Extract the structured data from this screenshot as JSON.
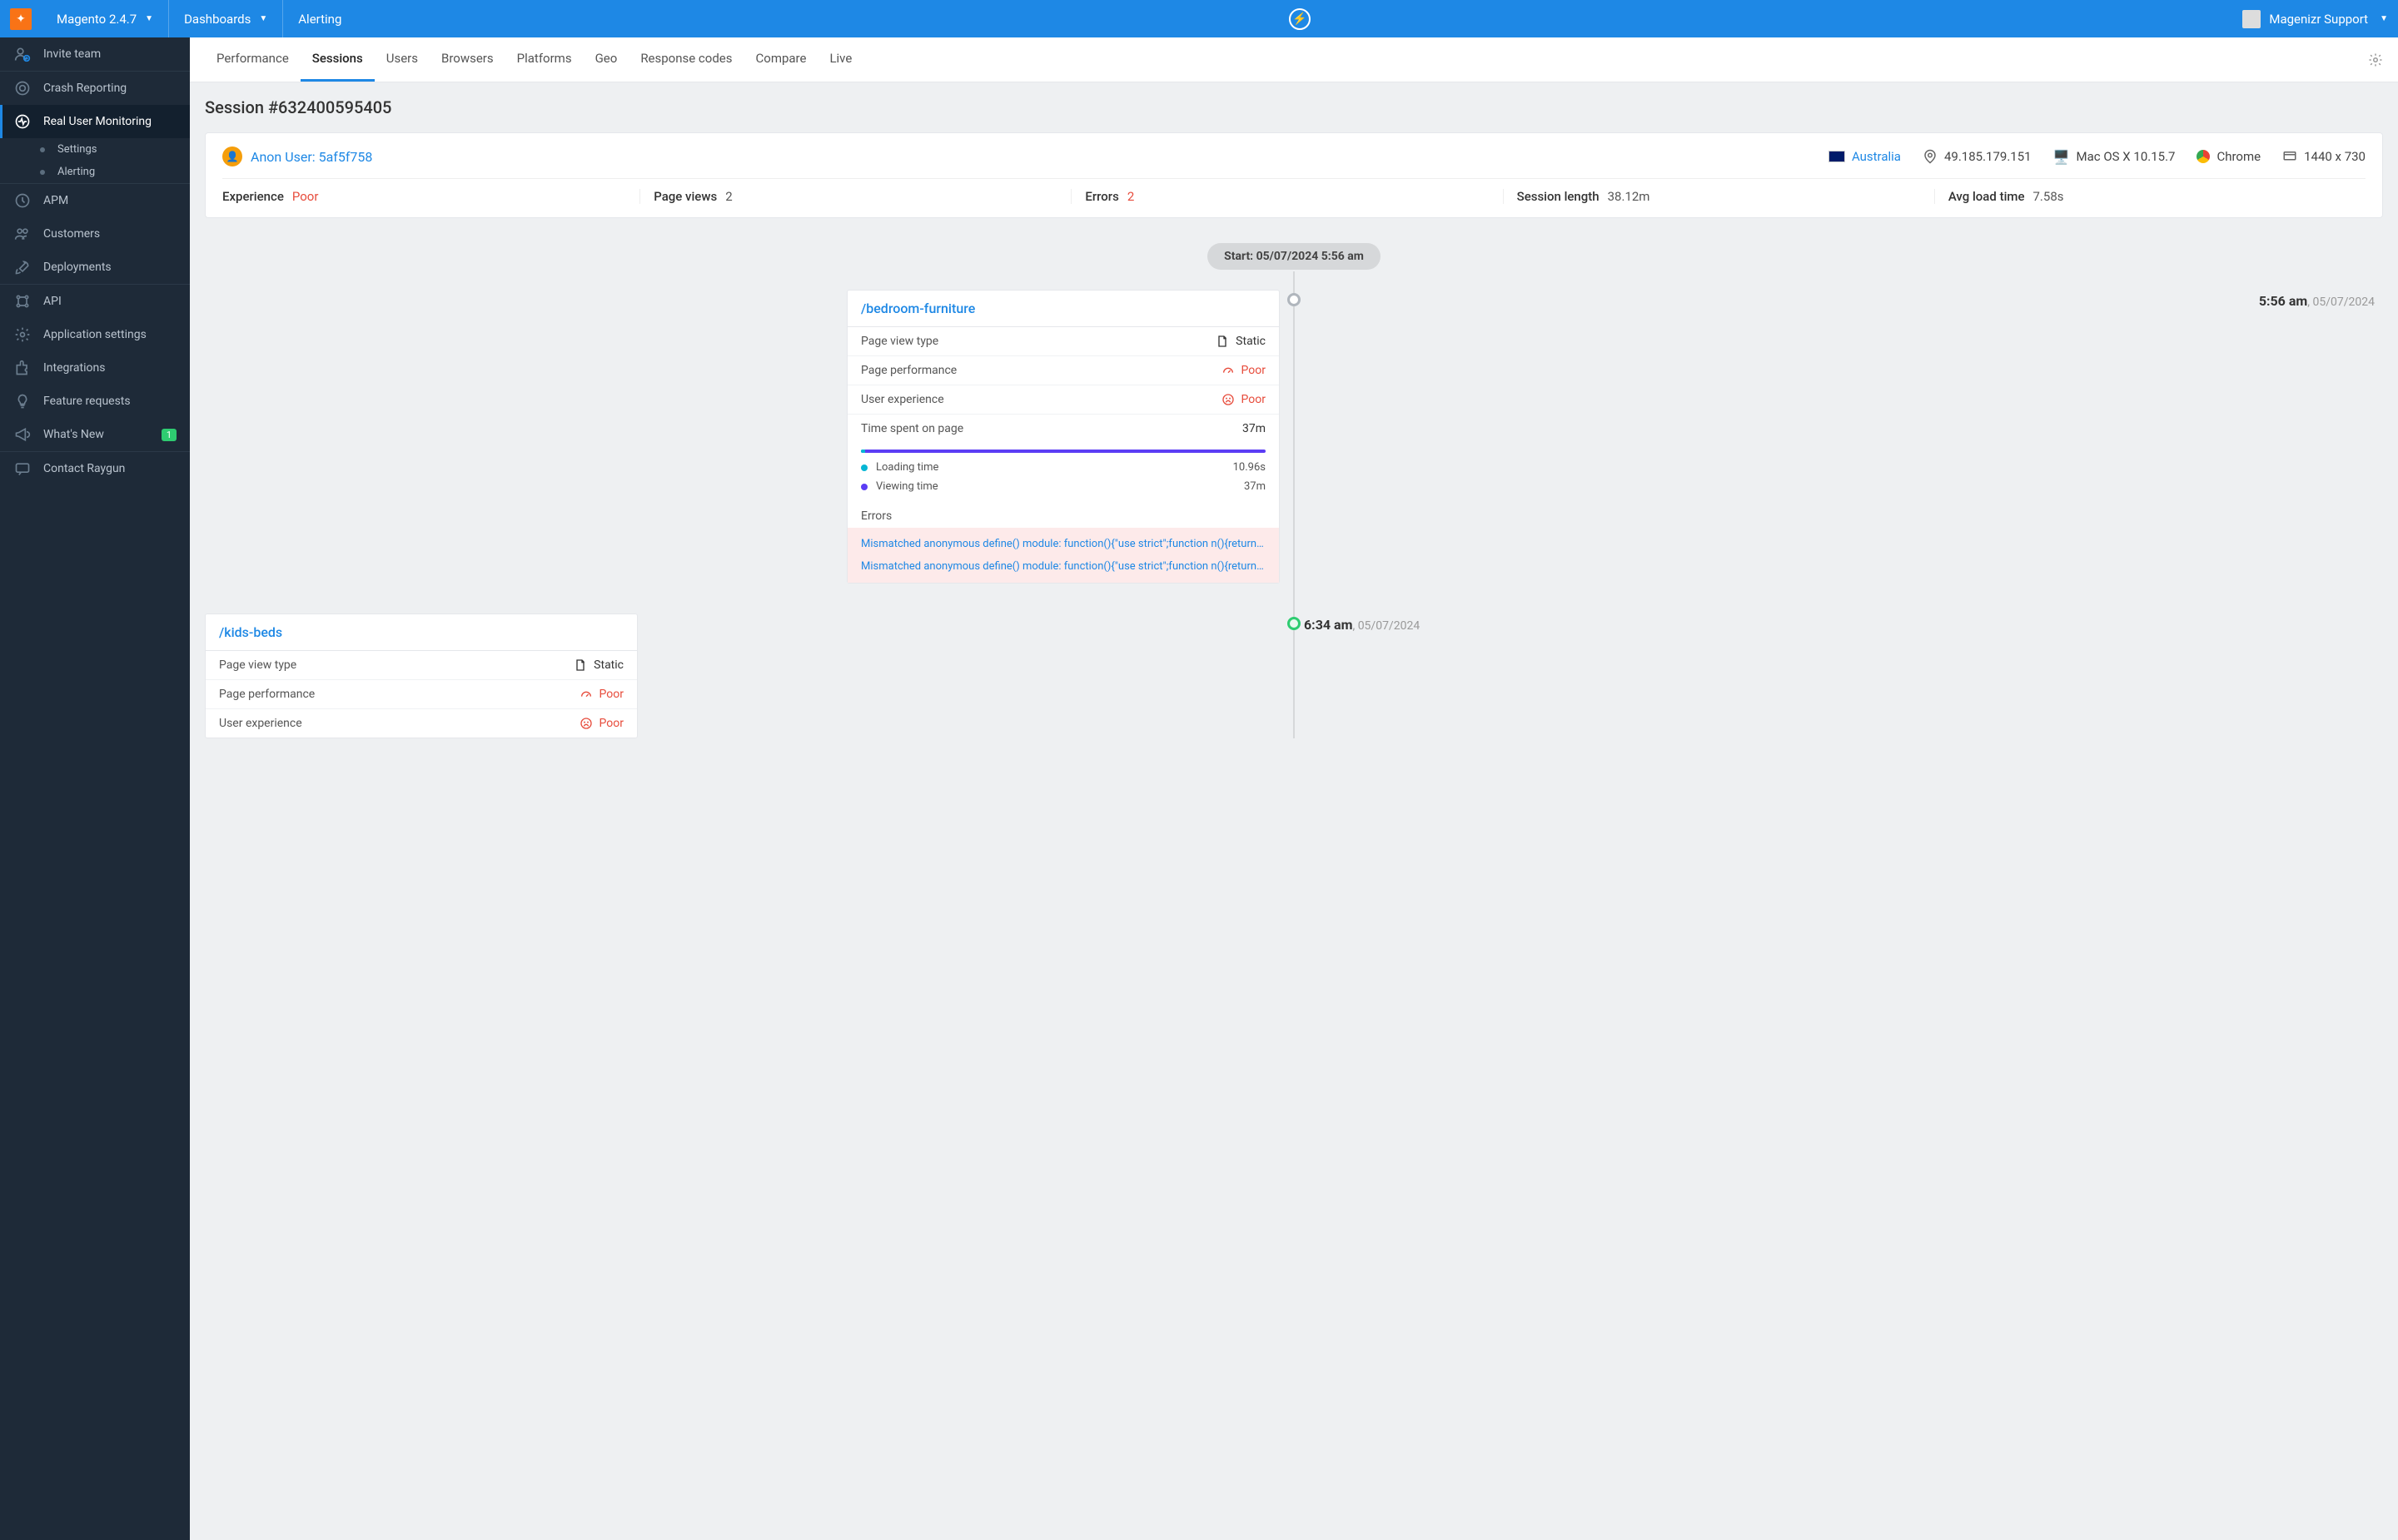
{
  "header": {
    "app": "Magento 2.4.7",
    "dashboards": "Dashboards",
    "alerting": "Alerting",
    "user": "Magenizr Support"
  },
  "sidebar": {
    "invite": "Invite team",
    "crash": "Crash Reporting",
    "rum": "Real User Monitoring",
    "rum_settings": "Settings",
    "rum_alerting": "Alerting",
    "apm": "APM",
    "customers": "Customers",
    "deployments": "Deployments",
    "api": "API",
    "app_settings": "Application settings",
    "integrations": "Integrations",
    "feature_requests": "Feature requests",
    "whats_new": "What's New",
    "whats_new_badge": "1",
    "contact": "Contact Raygun"
  },
  "tabs": [
    "Performance",
    "Sessions",
    "Users",
    "Browsers",
    "Platforms",
    "Geo",
    "Response codes",
    "Compare",
    "Live"
  ],
  "active_tab": "Sessions",
  "session_title": "Session #632400595405",
  "summary": {
    "anon_user": "Anon User: 5af5f758",
    "country": "Australia",
    "ip": "49.185.179.151",
    "os": "Mac OS X 10.15.7",
    "browser": "Chrome",
    "viewport": "1440 x 730",
    "experience_label": "Experience",
    "experience_value": "Poor",
    "page_views_label": "Page views",
    "page_views_value": "2",
    "errors_label": "Errors",
    "errors_value": "2",
    "session_length_label": "Session length",
    "session_length_value": "38.12m",
    "avg_load_label": "Avg load time",
    "avg_load_value": "7.58s"
  },
  "timeline": {
    "start": "Start: 05/07/2024 5:56 am",
    "events": [
      {
        "time": "5:56 am",
        "date": "05/07/2024",
        "url": "/bedroom-furniture",
        "page_view_type_label": "Page view type",
        "page_view_type": "Static",
        "page_perf_label": "Page performance",
        "page_perf": "Poor",
        "ux_label": "User experience",
        "ux": "Poor",
        "time_spent_label": "Time spent on page",
        "time_spent": "37m",
        "loading_label": "Loading time",
        "loading": "10.96s",
        "viewing_label": "Viewing time",
        "viewing": "37m",
        "errors_label": "Errors",
        "errors": [
          "Mismatched anonymous define() module: function(){\"use strict\";function n(){return n...",
          "Mismatched anonymous define() module: function(){\"use strict\";function n(){return n..."
        ]
      },
      {
        "time": "6:34 am",
        "date": "05/07/2024",
        "url": "/kids-beds",
        "page_view_type_label": "Page view type",
        "page_view_type": "Static",
        "page_perf_label": "Page performance",
        "page_perf": "Poor",
        "ux_label": "User experience",
        "ux": "Poor"
      }
    ]
  }
}
